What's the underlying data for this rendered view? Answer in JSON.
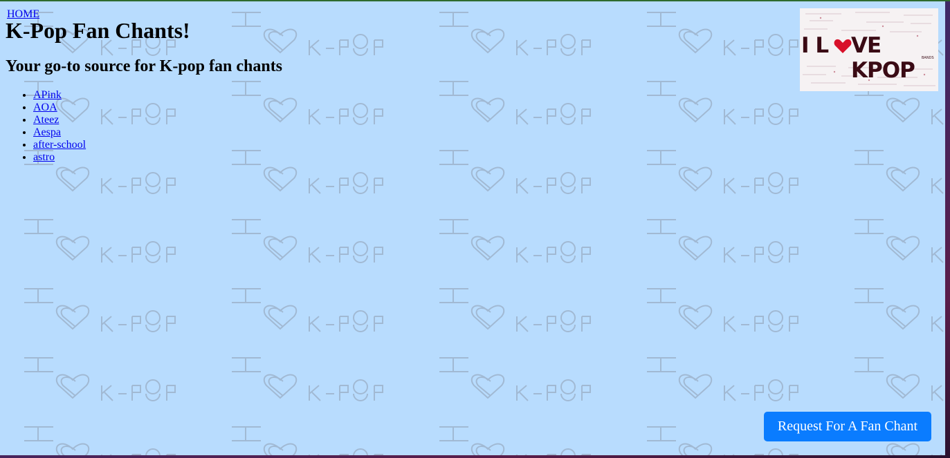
{
  "nav": {
    "home_label": "HOME"
  },
  "header": {
    "title": "K-Pop Fan Chants!",
    "subtitle": "Your go-to source for K-pop fan chants"
  },
  "groups": [
    {
      "label": "APink"
    },
    {
      "label": "AOA"
    },
    {
      "label": "Ateez"
    },
    {
      "label": "Aespa"
    },
    {
      "label": "after-school"
    },
    {
      "label": "astro"
    }
  ],
  "logo": {
    "text_left": "I L",
    "text_right": "VE KPOP",
    "tag": "BANDS"
  },
  "actions": {
    "request_label": "Request For A Fan Chant"
  },
  "colors": {
    "page_background": "#b8dcfe",
    "link": "#0000ee",
    "button": "#0a7cff",
    "logo_text": "#3a0a14",
    "logo_heart": "#d8102a"
  },
  "watermark": {
    "icon": "i-heart-kpop-pattern"
  }
}
